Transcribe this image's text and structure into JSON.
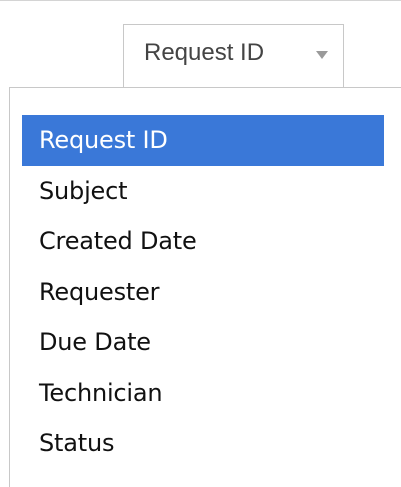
{
  "sort_select": {
    "selected_value": "Request ID",
    "caret_icon": "triangle-down-icon"
  },
  "dropdown": {
    "options": [
      {
        "label": "Request ID",
        "selected": true
      },
      {
        "label": "Subject",
        "selected": false
      },
      {
        "label": "Created Date",
        "selected": false
      },
      {
        "label": "Requester",
        "selected": false
      },
      {
        "label": "Due Date",
        "selected": false
      },
      {
        "label": "Technician",
        "selected": false
      },
      {
        "label": "Status",
        "selected": false
      }
    ],
    "highlight_color": "#3a78d8"
  }
}
